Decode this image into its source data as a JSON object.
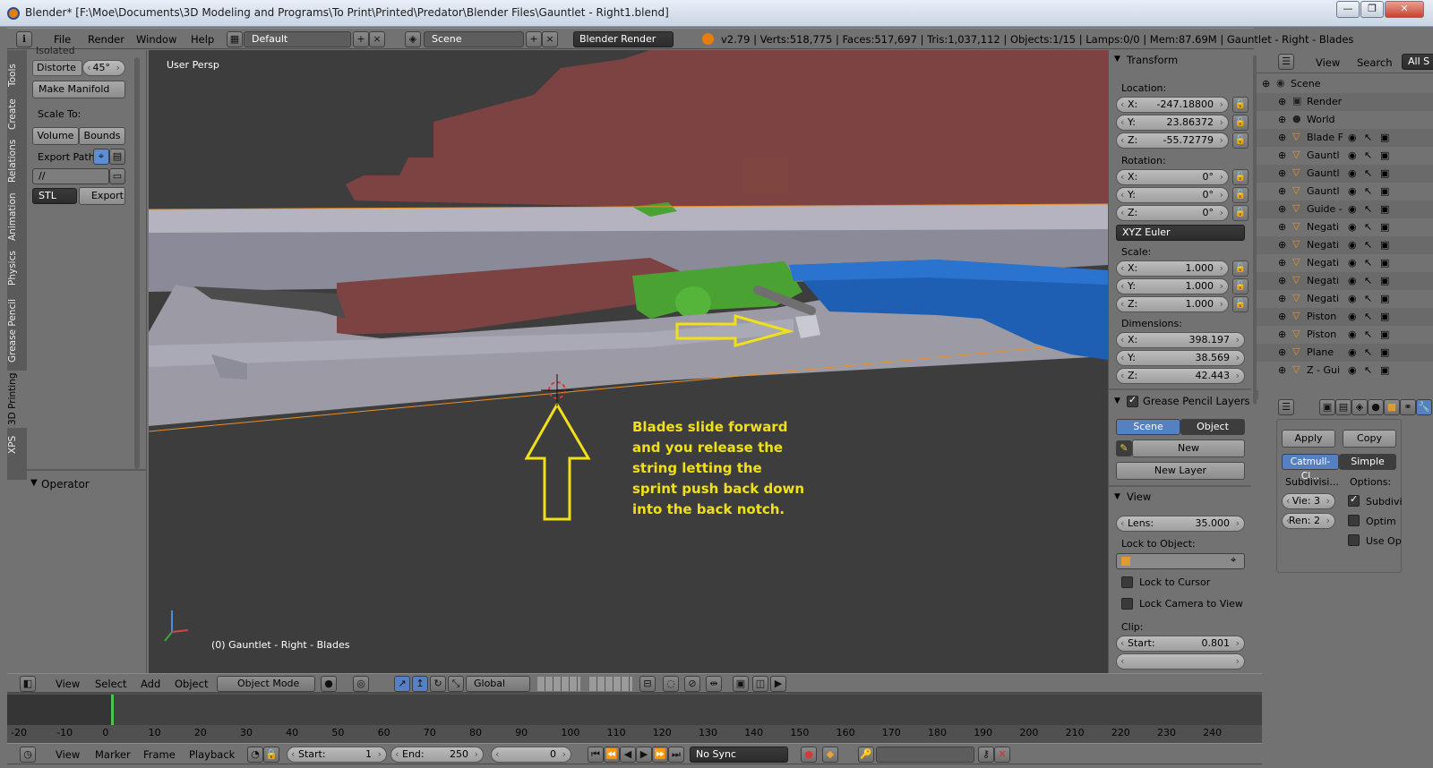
{
  "window": {
    "title": "Blender* [F:\\Moe\\Documents\\3D Modeling and Programs\\To Print\\Printed\\Predator\\Blender Files\\Gauntlet - Right1.blend]",
    "controls": [
      "—",
      "❐",
      "✕"
    ]
  },
  "info_header": {
    "menus": [
      "File",
      "Render",
      "Window",
      "Help"
    ],
    "layout": "Default",
    "scene": "Scene",
    "engine": "Blender Render",
    "stats": "v2.79 | Verts:518,775 | Faces:517,697 | Tris:1,037,112 | Objects:1/15 | Lamps:0/0 | Mem:87.69M | Gauntlet - Right - Blades"
  },
  "tool_tabs": [
    "Tools",
    "Create",
    "Relations",
    "Animation",
    "Physics",
    "Grease Pencil",
    "3D Printing",
    "XPS"
  ],
  "toolshelf": {
    "isolated": "Isolated",
    "distort_label": "Distorte",
    "distort_value": "45°",
    "make_manifold": "Make Manifold",
    "scale_to": "Scale To:",
    "volume": "Volume",
    "bounds": "Bounds",
    "export_path": "Export Path:",
    "path_value": "//",
    "format": "STL",
    "export": "Export",
    "operator": "Operator"
  },
  "viewport": {
    "view_name": "User Persp",
    "object_name": "(0) Gauntlet - Right - Blades",
    "annotation": [
      "Blades slide forward",
      "and you release the",
      "string letting the",
      "sprint push back down",
      "into the back notch."
    ]
  },
  "npanel": {
    "transform": "Transform",
    "location": "Location:",
    "loc": [
      {
        "a": "X:",
        "v": "-247.18800"
      },
      {
        "a": "Y:",
        "v": "23.86372"
      },
      {
        "a": "Z:",
        "v": "-55.72779"
      }
    ],
    "rotation": "Rotation:",
    "rot": [
      {
        "a": "X:",
        "v": "0°"
      },
      {
        "a": "Y:",
        "v": "0°"
      },
      {
        "a": "Z:",
        "v": "0°"
      }
    ],
    "rot_mode": "XYZ Euler",
    "scale": "Scale:",
    "scl": [
      {
        "a": "X:",
        "v": "1.000"
      },
      {
        "a": "Y:",
        "v": "1.000"
      },
      {
        "a": "Z:",
        "v": "1.000"
      }
    ],
    "dimensions": "Dimensions:",
    "dim": [
      {
        "a": "X:",
        "v": "398.197"
      },
      {
        "a": "Y:",
        "v": "38.569"
      },
      {
        "a": "Z:",
        "v": "42.443"
      }
    ],
    "gp_layers": "Grease Pencil Layers",
    "gp_scene": "Scene",
    "gp_object": "Object",
    "gp_new": "New",
    "gp_new_layer": "New Layer",
    "view": "View",
    "lens_label": "Lens:",
    "lens_value": "35.000",
    "lock_to_object": "Lock to Object:",
    "lock_to_cursor": "Lock to Cursor",
    "lock_camera": "Lock Camera to View",
    "clip": "Clip:",
    "clip_start_label": "Start:",
    "clip_start_value": "0.801"
  },
  "outliner": {
    "menus": [
      "View",
      "Search",
      "All S"
    ],
    "items": [
      {
        "name": "Scene",
        "icon": "scene-icon",
        "level": 0
      },
      {
        "name": "Render",
        "icon": "render-icon",
        "level": 1
      },
      {
        "name": "World",
        "icon": "world-icon",
        "level": 1
      },
      {
        "name": "Blade F",
        "icon": "mesh-icon",
        "level": 1
      },
      {
        "name": "Gauntl",
        "icon": "mesh-icon",
        "level": 1
      },
      {
        "name": "Gauntl",
        "icon": "mesh-icon",
        "level": 1
      },
      {
        "name": "Gauntl",
        "icon": "mesh-icon",
        "level": 1
      },
      {
        "name": "Guide -",
        "icon": "mesh-icon",
        "level": 1
      },
      {
        "name": "Negati",
        "icon": "mesh-icon",
        "level": 1
      },
      {
        "name": "Negati",
        "icon": "mesh-icon",
        "level": 1
      },
      {
        "name": "Negati",
        "icon": "mesh-icon",
        "level": 1
      },
      {
        "name": "Negati",
        "icon": "mesh-icon",
        "level": 1
      },
      {
        "name": "Negati",
        "icon": "mesh-icon",
        "level": 1
      },
      {
        "name": "Piston",
        "icon": "mesh-icon",
        "level": 1
      },
      {
        "name": "Piston",
        "icon": "mesh-icon",
        "level": 1
      },
      {
        "name": "Plane",
        "icon": "mesh-icon",
        "level": 1
      },
      {
        "name": "Z - Gui",
        "icon": "mesh-icon",
        "level": 1
      }
    ]
  },
  "modifier": {
    "apply": "Apply",
    "copy": "Copy",
    "catmull": "Catmull-Cl...",
    "simple": "Simple",
    "subdivisions": "Subdivisi...",
    "options": "Options:",
    "view_levels": "Vie: 3",
    "render_levels": "Ren: 2",
    "subdiv_uv": "Subdivi",
    "optimal": "Optim",
    "use_opensubdiv": "Use Op"
  },
  "view3d_header": {
    "menus": [
      "View",
      "Select",
      "Add",
      "Object"
    ],
    "mode": "Object Mode",
    "orientation": "Global"
  },
  "timeline": {
    "ruler": [
      "-20",
      "-10",
      "0",
      "10",
      "20",
      "30",
      "40",
      "50",
      "60",
      "70",
      "80",
      "90",
      "100",
      "110",
      "120",
      "130",
      "140",
      "150",
      "160",
      "170",
      "180",
      "190",
      "200",
      "210",
      "220",
      "230",
      "240"
    ],
    "menus": [
      "View",
      "Marker",
      "Frame",
      "Playback"
    ],
    "start_label": "Start:",
    "start_value": "1",
    "end_label": "End:",
    "end_value": "250",
    "current": "0",
    "sync": "No Sync"
  }
}
